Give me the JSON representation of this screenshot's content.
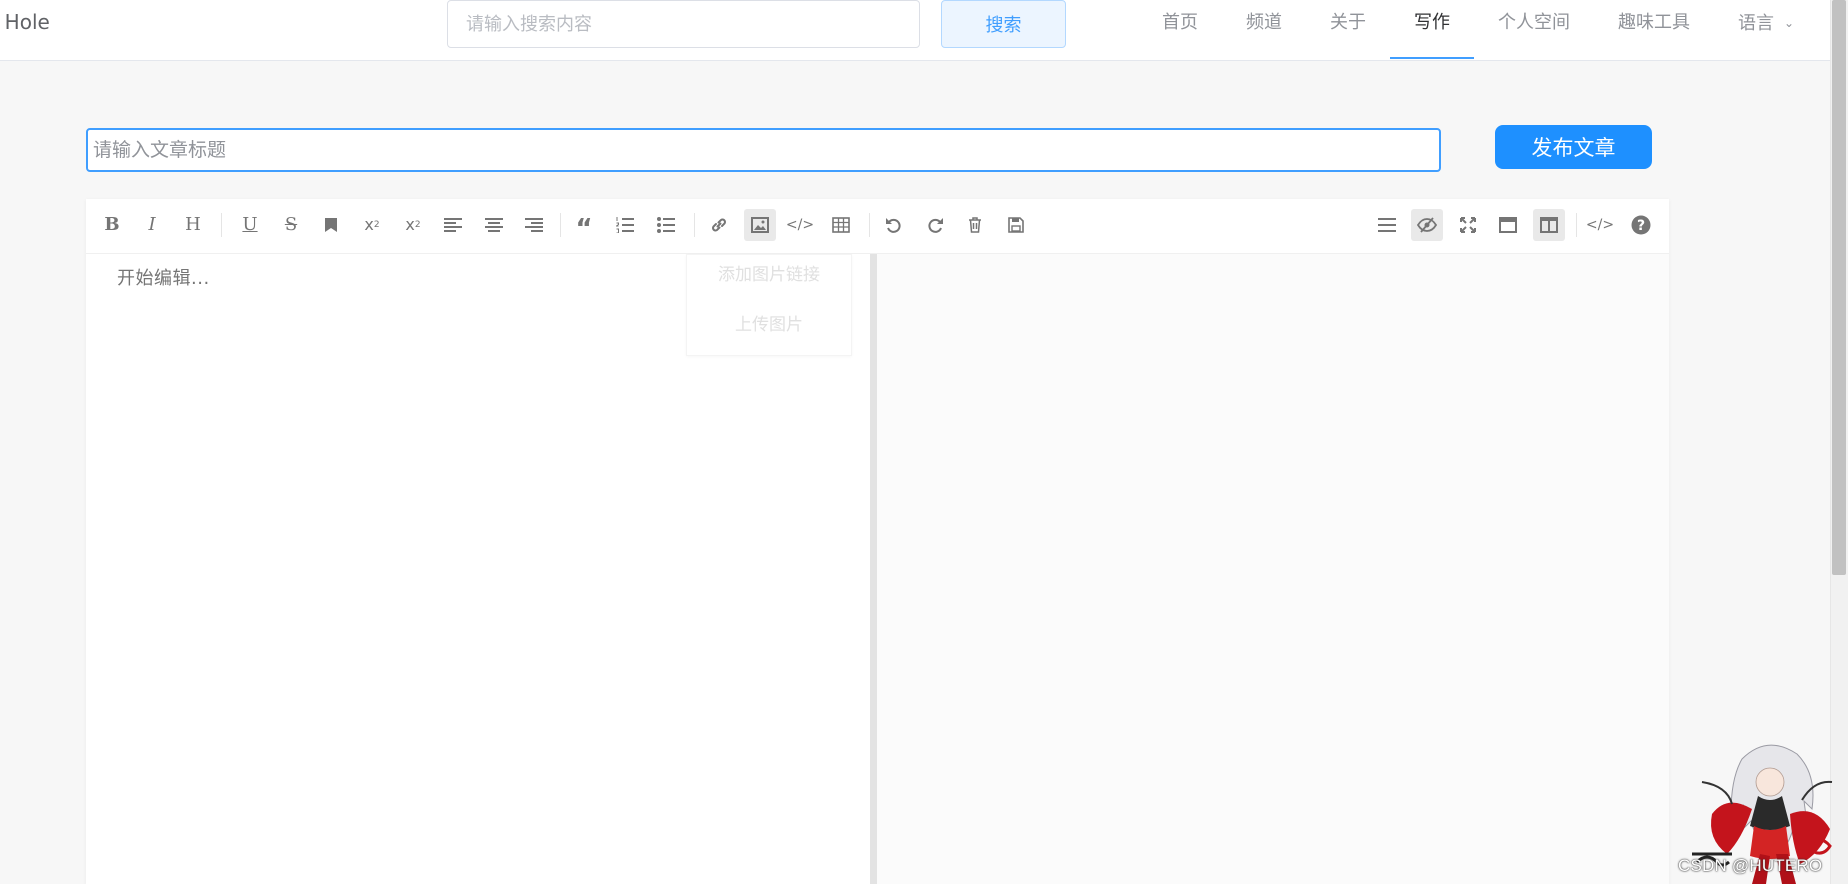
{
  "header": {
    "brand": "e Hole",
    "search_placeholder": "请输入搜索内容",
    "search_button": "搜索",
    "nav": [
      {
        "label": "首页",
        "active": false
      },
      {
        "label": "频道",
        "active": false
      },
      {
        "label": "关于",
        "active": false
      },
      {
        "label": "写作",
        "active": true
      },
      {
        "label": "个人空间",
        "active": false
      },
      {
        "label": "趣味工具",
        "active": false
      },
      {
        "label": "语言",
        "active": false
      }
    ]
  },
  "editor": {
    "title_placeholder": "请输入文章标题",
    "publish_button": "发布文章",
    "content_placeholder": "开始编辑...",
    "image_menu": [
      "添加图片链接",
      "上传图片"
    ]
  },
  "toolbar_left": [
    "bold-icon",
    "italic-icon",
    "heading-icon",
    "underline-icon",
    "strikethrough-icon",
    "mark-icon",
    "superscript-icon",
    "subscript-icon",
    "align-left-icon",
    "align-center-icon",
    "align-right-icon",
    "quote-icon",
    "ordered-list-icon",
    "unordered-list-icon",
    "link-icon",
    "image-icon",
    "code-icon",
    "table-icon",
    "undo-icon",
    "redo-icon",
    "trash-icon",
    "save-icon"
  ],
  "toolbar_right": [
    "navigation-icon",
    "preview-toggle-icon",
    "fullscreen-icon",
    "read-mode-icon",
    "subfield-icon",
    "html-code-icon",
    "help-icon"
  ],
  "watermark": "CSDN @HUTERO",
  "colors": {
    "accent": "#409eff",
    "publish": "#1e90ff"
  }
}
